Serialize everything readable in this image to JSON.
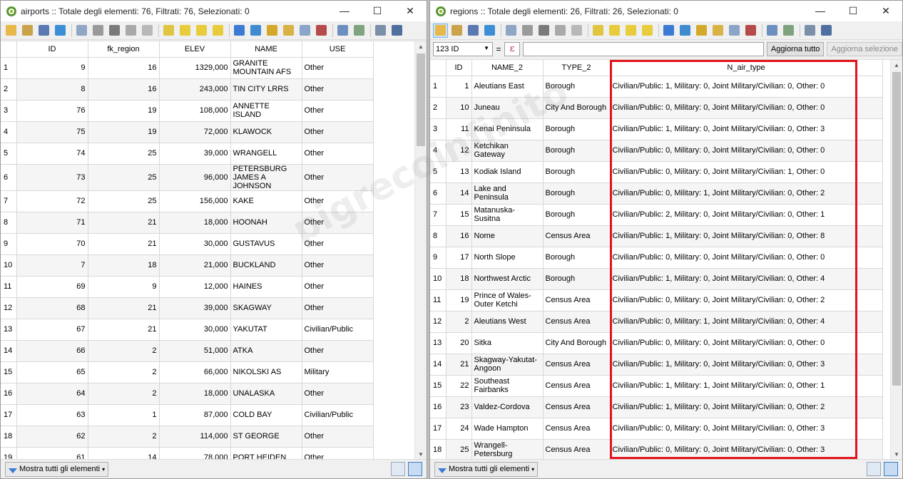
{
  "left": {
    "title": "airports :: Totale degli elementi: 76, Filtrati: 76, Selezionati: 0",
    "columns": [
      "ID",
      "fk_region",
      "ELEV",
      "NAME",
      "USE"
    ],
    "rows": [
      [
        "1",
        "9",
        "16",
        "1329,000",
        "GRANITE MOUNTAIN AFS",
        "Other"
      ],
      [
        "2",
        "8",
        "16",
        "243,000",
        "TIN CITY LRRS",
        "Other"
      ],
      [
        "3",
        "76",
        "19",
        "108,000",
        "ANNETTE ISLAND",
        "Other"
      ],
      [
        "4",
        "75",
        "19",
        "72,000",
        "KLAWOCK",
        "Other"
      ],
      [
        "5",
        "74",
        "25",
        "39,000",
        "WRANGELL",
        "Other"
      ],
      [
        "6",
        "73",
        "25",
        "96,000",
        "PETERSBURG JAMES A JOHNSON",
        "Other"
      ],
      [
        "7",
        "72",
        "25",
        "156,000",
        "KAKE",
        "Other"
      ],
      [
        "8",
        "71",
        "21",
        "18,000",
        "HOONAH",
        "Other"
      ],
      [
        "9",
        "70",
        "21",
        "30,000",
        "GUSTAVUS",
        "Other"
      ],
      [
        "10",
        "7",
        "18",
        "21,000",
        "BUCKLAND",
        "Other"
      ],
      [
        "11",
        "69",
        "9",
        "12,000",
        "HAINES",
        "Other"
      ],
      [
        "12",
        "68",
        "21",
        "39,000",
        "SKAGWAY",
        "Other"
      ],
      [
        "13",
        "67",
        "21",
        "30,000",
        "YAKUTAT",
        "Civilian/Public"
      ],
      [
        "14",
        "66",
        "2",
        "51,000",
        "ATKA",
        "Other"
      ],
      [
        "15",
        "65",
        "2",
        "66,000",
        "NIKOLSKI AS",
        "Military"
      ],
      [
        "16",
        "64",
        "2",
        "18,000",
        "UNALASKA",
        "Other"
      ],
      [
        "17",
        "63",
        "1",
        "87,000",
        "COLD BAY",
        "Civilian/Public"
      ],
      [
        "18",
        "62",
        "2",
        "114,000",
        "ST GEORGE",
        "Other"
      ],
      [
        "19",
        "61",
        "14",
        "78,000",
        "PORT HEIDEN",
        "Other"
      ]
    ],
    "show_all": "Mostra tutti gli elementi"
  },
  "right": {
    "title": "regions :: Totale degli elementi: 26, Filtrati: 26, Selezionati: 0",
    "field_select": "123 ID",
    "equals": "=",
    "epsilon": "ε",
    "expression_value": "",
    "update_all": "Aggiorna tutto",
    "update_selection": "Aggiorna selezione",
    "columns": [
      "ID",
      "NAME_2",
      "TYPE_2",
      "N_air_type"
    ],
    "rows": [
      [
        "1",
        "1",
        "Aleutians East",
        "Borough",
        "Civilian/Public: 1, Military: 0, Joint Military/Civilian: 0, Other: 0"
      ],
      [
        "2",
        "10",
        "Juneau",
        "City And Borough",
        "Civilian/Public: 0, Military: 0, Joint Military/Civilian: 0, Other: 0"
      ],
      [
        "3",
        "11",
        "Kenai Peninsula",
        "Borough",
        "Civilian/Public: 1, Military: 0, Joint Military/Civilian: 0, Other: 3"
      ],
      [
        "4",
        "12",
        "Ketchikan Gateway",
        "Borough",
        "Civilian/Public: 0, Military: 0, Joint Military/Civilian: 0, Other: 0"
      ],
      [
        "5",
        "13",
        "Kodiak Island",
        "Borough",
        "Civilian/Public: 0, Military: 0, Joint Military/Civilian: 1, Other: 0"
      ],
      [
        "6",
        "14",
        "Lake and Peninsula",
        "Borough",
        "Civilian/Public: 0, Military: 1, Joint Military/Civilian: 0, Other: 2"
      ],
      [
        "7",
        "15",
        "Matanuska-Susitna",
        "Borough",
        "Civilian/Public: 2, Military: 0, Joint Military/Civilian: 0, Other: 1"
      ],
      [
        "8",
        "16",
        "Nome",
        "Census Area",
        "Civilian/Public: 1, Military: 0, Joint Military/Civilian: 0, Other: 8"
      ],
      [
        "9",
        "17",
        "North Slope",
        "Borough",
        "Civilian/Public: 0, Military: 0, Joint Military/Civilian: 0, Other: 0"
      ],
      [
        "10",
        "18",
        "Northwest Arctic",
        "Borough",
        "Civilian/Public: 1, Military: 0, Joint Military/Civilian: 0, Other: 4"
      ],
      [
        "11",
        "19",
        "Prince of Wales-Outer Ketchi",
        "Census Area",
        "Civilian/Public: 0, Military: 0, Joint Military/Civilian: 0, Other: 2"
      ],
      [
        "12",
        "2",
        "Aleutians West",
        "Census Area",
        "Civilian/Public: 0, Military: 1, Joint Military/Civilian: 0, Other: 4"
      ],
      [
        "13",
        "20",
        "Sitka",
        "City And Borough",
        "Civilian/Public: 0, Military: 0, Joint Military/Civilian: 0, Other: 0"
      ],
      [
        "14",
        "21",
        "Skagway-Yakutat-Angoon",
        "Census Area",
        "Civilian/Public: 1, Military: 0, Joint Military/Civilian: 0, Other: 3"
      ],
      [
        "15",
        "22",
        "Southeast Fairbanks",
        "Census Area",
        "Civilian/Public: 1, Military: 1, Joint Military/Civilian: 0, Other: 1"
      ],
      [
        "16",
        "23",
        "Valdez-Cordova",
        "Census Area",
        "Civilian/Public: 1, Military: 0, Joint Military/Civilian: 0, Other: 2"
      ],
      [
        "17",
        "24",
        "Wade Hampton",
        "Census Area",
        "Civilian/Public: 0, Military: 0, Joint Military/Civilian: 0, Other: 3"
      ],
      [
        "18",
        "25",
        "Wrangell-Petersburg",
        "Census Area",
        "Civilian/Public: 0, Military: 0, Joint Military/Civilian: 0, Other: 3"
      ]
    ],
    "show_all": "Mostra tutti gli elementi"
  },
  "window_controls": {
    "minimize": "—",
    "maximize": "☐",
    "close": "✕"
  },
  "watermark": "pigrecoinfinito",
  "icons": {
    "toolbar_left": [
      "edit-pencil-icon",
      "multi-edit-icon",
      "save-icon",
      "reload-icon",
      "add-feature-icon",
      "delete-feature-icon",
      "cut-icon",
      "copy-icon",
      "paste-icon",
      "select-expression-icon",
      "select-all-icon",
      "invert-selection-icon",
      "deselect-icon",
      "filter-selection-icon",
      "move-selection-top-icon",
      "pan-to-selected-icon",
      "zoom-to-selected-icon",
      "new-field-icon",
      "delete-field-icon",
      "field-calculator-icon",
      "conditional-formatting-icon",
      "dock-icon",
      "actions-icon"
    ],
    "colors": {
      "accent_red": "#e0151b",
      "qgis_green": "#589632",
      "selection_blue": "#cce4f7"
    }
  }
}
